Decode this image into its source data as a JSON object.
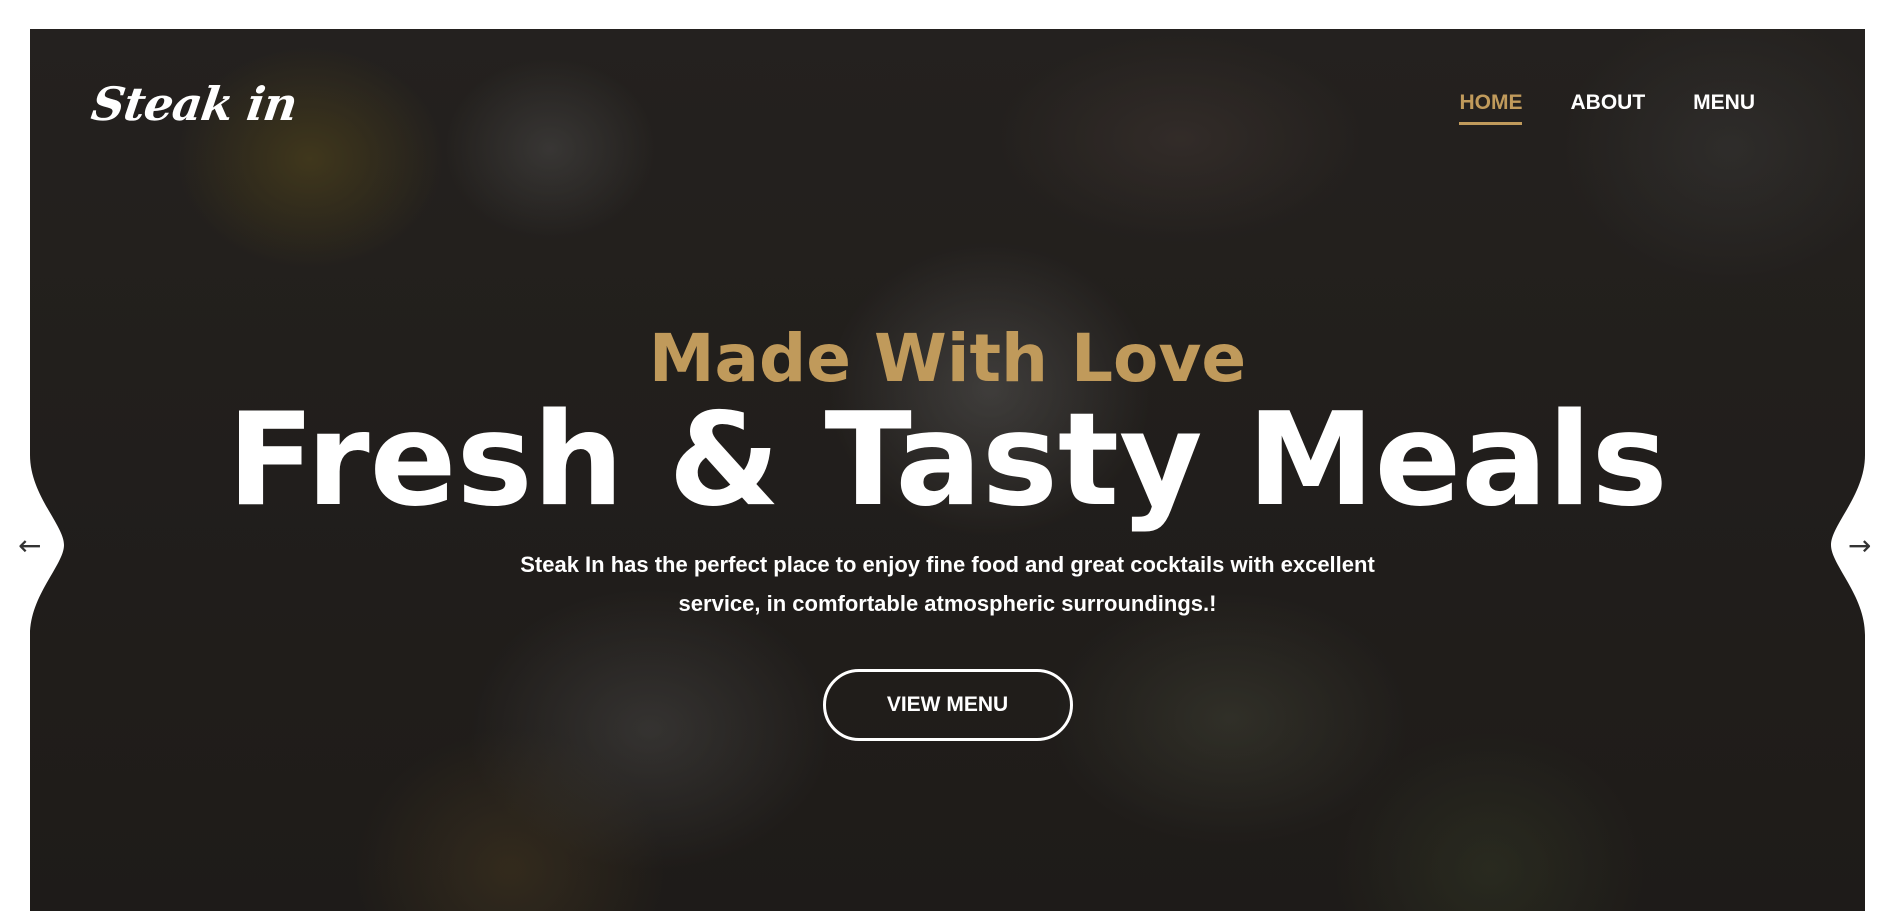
{
  "brand": {
    "logo_text": "Steak in"
  },
  "nav": {
    "items": [
      {
        "label": "HOME",
        "active": true
      },
      {
        "label": "ABOUT",
        "active": false
      },
      {
        "label": "MENU",
        "active": false
      }
    ]
  },
  "hero": {
    "subtitle": "Made With Love",
    "title": "Fresh & Tasty Meals",
    "description": "Steak In has the perfect place to enjoy fine food and great cocktails with excellent service, in comfortable atmospheric surroundings.!",
    "cta_label": "VIEW MENU"
  },
  "slider": {
    "prev_icon": "arrow-left-icon",
    "next_icon": "arrow-right-icon"
  },
  "colors": {
    "accent": "#c09a5b",
    "text": "#ffffff",
    "overlay": "#262220"
  }
}
